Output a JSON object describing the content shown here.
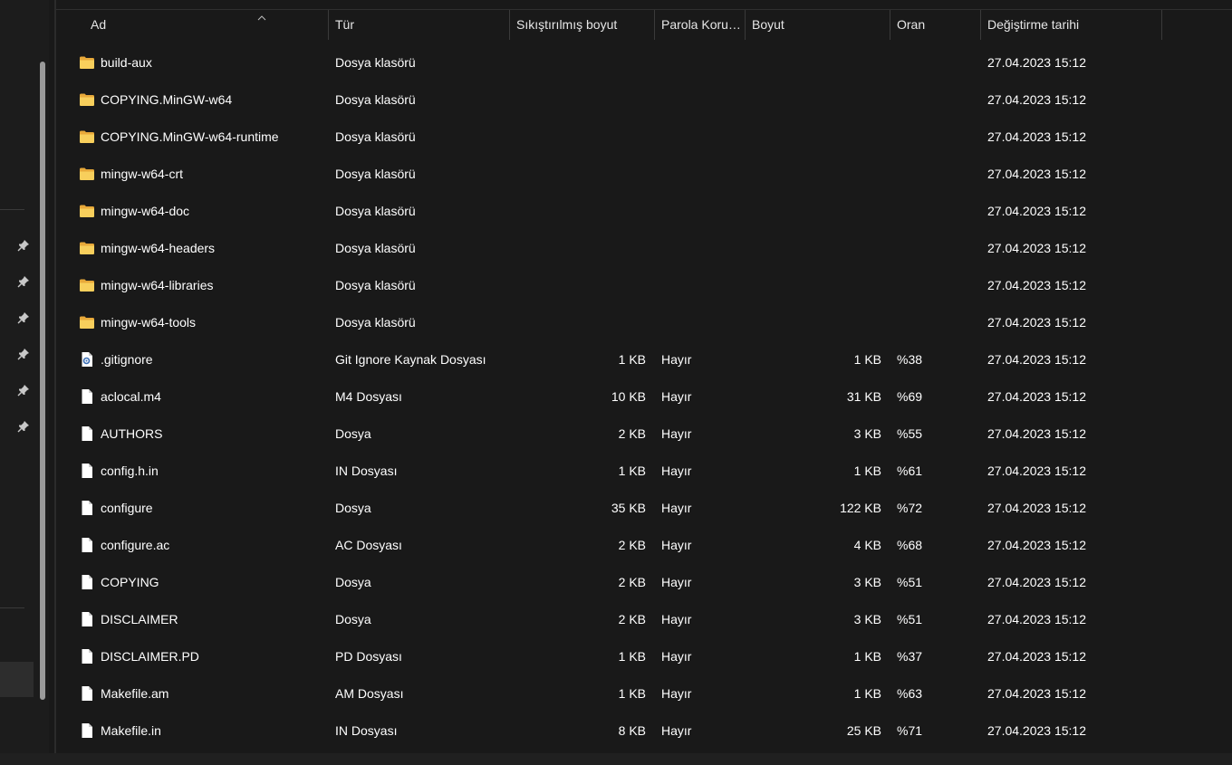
{
  "columns": {
    "name": "Ad",
    "type": "Tür",
    "compressed_size": "Sıkıştırılmış boyut",
    "password": "Parola Koru…",
    "size": "Boyut",
    "ratio": "Oran",
    "modified": "Değiştirme tarihi"
  },
  "rows": [
    {
      "name": "build-aux",
      "type": "Dosya klasörü",
      "compressed": "",
      "password": "",
      "size": "",
      "ratio": "",
      "modified": "27.04.2023 15:12",
      "icon": "folder-icon"
    },
    {
      "name": "COPYING.MinGW-w64",
      "type": "Dosya klasörü",
      "compressed": "",
      "password": "",
      "size": "",
      "ratio": "",
      "modified": "27.04.2023 15:12",
      "icon": "folder-icon"
    },
    {
      "name": "COPYING.MinGW-w64-runtime",
      "type": "Dosya klasörü",
      "compressed": "",
      "password": "",
      "size": "",
      "ratio": "",
      "modified": "27.04.2023 15:12",
      "icon": "folder-icon"
    },
    {
      "name": "mingw-w64-crt",
      "type": "Dosya klasörü",
      "compressed": "",
      "password": "",
      "size": "",
      "ratio": "",
      "modified": "27.04.2023 15:12",
      "icon": "folder-icon"
    },
    {
      "name": "mingw-w64-doc",
      "type": "Dosya klasörü",
      "compressed": "",
      "password": "",
      "size": "",
      "ratio": "",
      "modified": "27.04.2023 15:12",
      "icon": "folder-icon"
    },
    {
      "name": "mingw-w64-headers",
      "type": "Dosya klasörü",
      "compressed": "",
      "password": "",
      "size": "",
      "ratio": "",
      "modified": "27.04.2023 15:12",
      "icon": "folder-icon"
    },
    {
      "name": "mingw-w64-libraries",
      "type": "Dosya klasörü",
      "compressed": "",
      "password": "",
      "size": "",
      "ratio": "",
      "modified": "27.04.2023 15:12",
      "icon": "folder-icon"
    },
    {
      "name": "mingw-w64-tools",
      "type": "Dosya klasörü",
      "compressed": "",
      "password": "",
      "size": "",
      "ratio": "",
      "modified": "27.04.2023 15:12",
      "icon": "folder-icon"
    },
    {
      "name": ".gitignore",
      "type": "Git Ignore Kaynak Dosyası",
      "compressed": "1 KB",
      "password": "Hayır",
      "size": "1 KB",
      "ratio": "%38",
      "modified": "27.04.2023 15:12",
      "icon": "settings-file-icon"
    },
    {
      "name": "aclocal.m4",
      "type": "M4 Dosyası",
      "compressed": "10 KB",
      "password": "Hayır",
      "size": "31 KB",
      "ratio": "%69",
      "modified": "27.04.2023 15:12",
      "icon": "file-icon"
    },
    {
      "name": "AUTHORS",
      "type": "Dosya",
      "compressed": "2 KB",
      "password": "Hayır",
      "size": "3 KB",
      "ratio": "%55",
      "modified": "27.04.2023 15:12",
      "icon": "file-icon"
    },
    {
      "name": "config.h.in",
      "type": "IN Dosyası",
      "compressed": "1 KB",
      "password": "Hayır",
      "size": "1 KB",
      "ratio": "%61",
      "modified": "27.04.2023 15:12",
      "icon": "file-icon"
    },
    {
      "name": "configure",
      "type": "Dosya",
      "compressed": "35 KB",
      "password": "Hayır",
      "size": "122 KB",
      "ratio": "%72",
      "modified": "27.04.2023 15:12",
      "icon": "file-icon"
    },
    {
      "name": "configure.ac",
      "type": "AC Dosyası",
      "compressed": "2 KB",
      "password": "Hayır",
      "size": "4 KB",
      "ratio": "%68",
      "modified": "27.04.2023 15:12",
      "icon": "file-icon"
    },
    {
      "name": "COPYING",
      "type": "Dosya",
      "compressed": "2 KB",
      "password": "Hayır",
      "size": "3 KB",
      "ratio": "%51",
      "modified": "27.04.2023 15:12",
      "icon": "file-icon"
    },
    {
      "name": "DISCLAIMER",
      "type": "Dosya",
      "compressed": "2 KB",
      "password": "Hayır",
      "size": "3 KB",
      "ratio": "%51",
      "modified": "27.04.2023 15:12",
      "icon": "file-icon"
    },
    {
      "name": "DISCLAIMER.PD",
      "type": "PD Dosyası",
      "compressed": "1 KB",
      "password": "Hayır",
      "size": "1 KB",
      "ratio": "%37",
      "modified": "27.04.2023 15:12",
      "icon": "file-icon"
    },
    {
      "name": "Makefile.am",
      "type": "AM Dosyası",
      "compressed": "1 KB",
      "password": "Hayır",
      "size": "1 KB",
      "ratio": "%63",
      "modified": "27.04.2023 15:12",
      "icon": "file-icon"
    },
    {
      "name": "Makefile.in",
      "type": "IN Dosyası",
      "compressed": "8 KB",
      "password": "Hayır",
      "size": "25 KB",
      "ratio": "%71",
      "modified": "27.04.2023 15:12",
      "icon": "file-icon"
    }
  ],
  "sort": {
    "column": "name",
    "direction": "ascending"
  },
  "nav_pane": {
    "pinned_item_count": 6
  },
  "colors": {
    "background": "#191919",
    "text": "#ffffff",
    "folder": "#f5c542",
    "header_text": "#e6e6e6",
    "scrollbar_thumb": "#9a9a9a"
  }
}
